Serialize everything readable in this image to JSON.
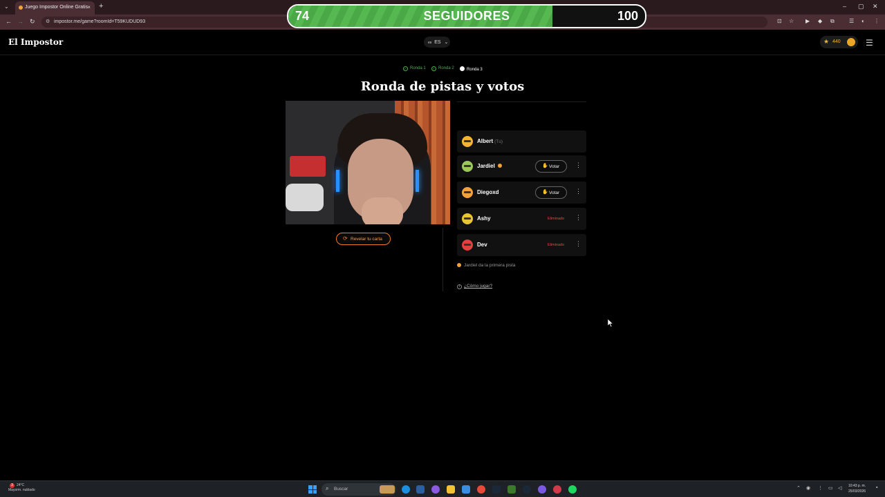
{
  "browser": {
    "tab_title": "Juego Impostor Online Gratis",
    "tab_close": "×",
    "new_tab": "+",
    "url": "impostor.me/game?roomId=T59KUDUD93",
    "window_controls": [
      "–",
      "▢",
      "✕"
    ]
  },
  "overlay": {
    "current": "74",
    "label": "SEGUIDORES",
    "goal": "100",
    "progress": 0.74,
    "fill_color": "#55b850"
  },
  "header": {
    "brand": "El Impostor",
    "lang_flag": "es",
    "lang_code": "ES",
    "coins": "440"
  },
  "rounds": [
    {
      "label": "Ronda 1",
      "status": "done"
    },
    {
      "label": "Ronda 2",
      "status": "done"
    },
    {
      "label": "Ronda 3",
      "status": "current"
    }
  ],
  "title": "Ronda de pistas y votos",
  "reveal_button": "Revelar tu carta",
  "players": [
    {
      "name": "Albert",
      "tag": "(Tú)",
      "avatar_color": "#f2b533",
      "action": "none"
    },
    {
      "name": "Jardiel",
      "tag": "",
      "avatar_color": "#9ac85a",
      "action": "vote",
      "vote_label": "Votar",
      "turn": true
    },
    {
      "name": "Diegoxd",
      "tag": "",
      "avatar_color": "#f2a23a",
      "action": "vote",
      "vote_label": "Votar"
    },
    {
      "name": "Ashy",
      "tag": "",
      "avatar_color": "#e8c533",
      "action": "eliminated",
      "status_label": "Eliminado"
    },
    {
      "name": "Dev",
      "tag": "",
      "avatar_color": "#e04040",
      "action": "eliminated",
      "status_label": "Eliminado"
    }
  ],
  "hint": "Jardiel da la primera pista",
  "howto": "¿Cómo jugar?",
  "taskbar": {
    "weather_badge": "3",
    "temp": "24°C",
    "weather": "Mayorm. nublado",
    "search_placeholder": "Buscar",
    "time": "10:43 p. m.",
    "date": "25/03/2026"
  }
}
